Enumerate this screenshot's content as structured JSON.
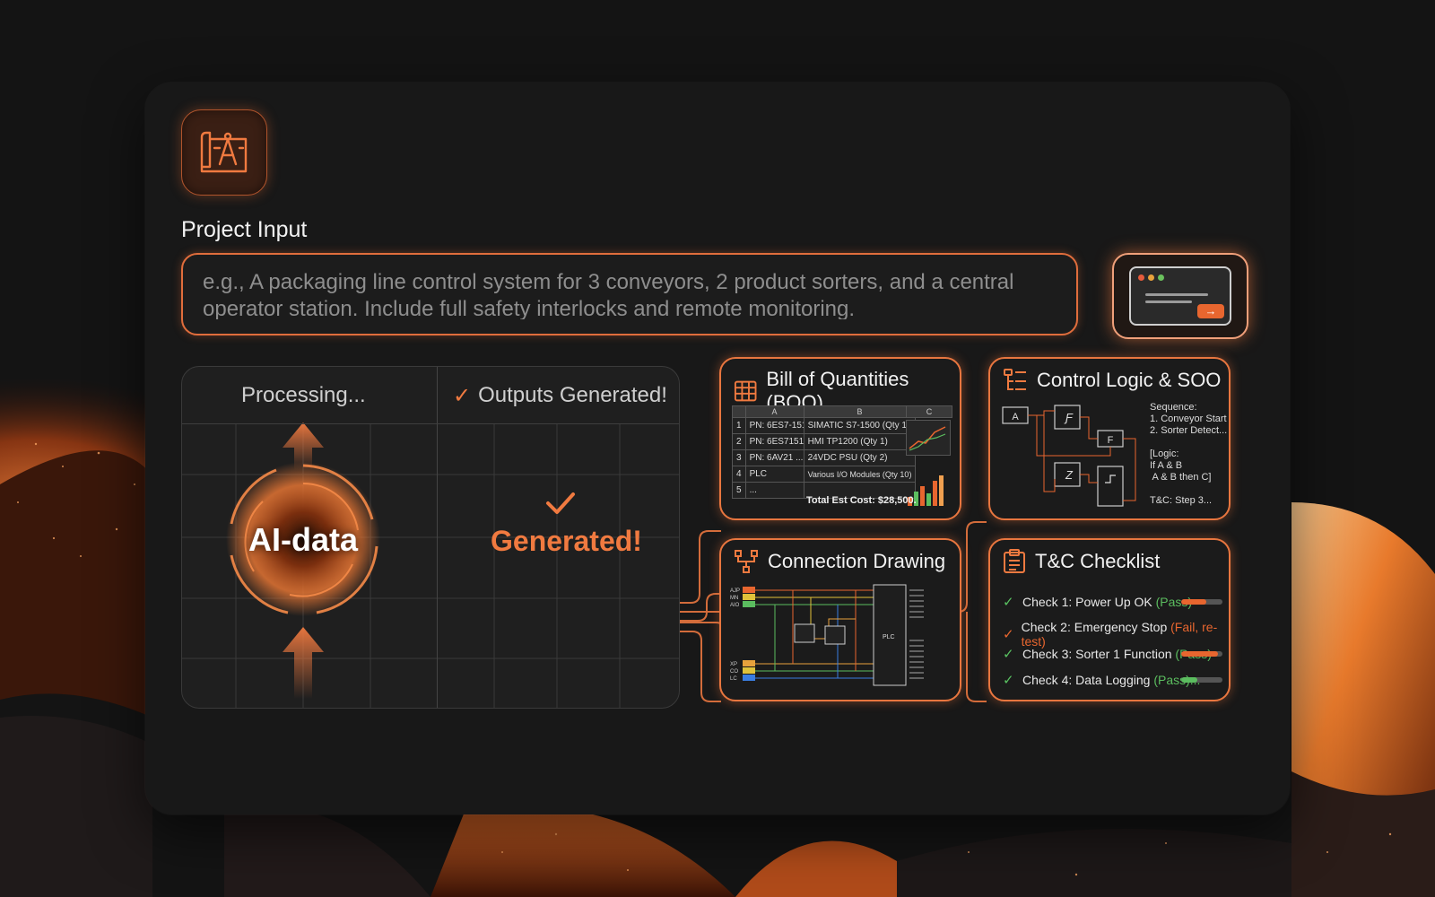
{
  "project": {
    "section_title": "Project Input",
    "placeholder": "e.g., A packaging line control system for 3 conveyors, 2 product sorters, and a central operator station. Include full safety interlocks and remote monitoring."
  },
  "processing": {
    "left_label": "Processing...",
    "right_label": "Outputs Generated!",
    "check_glyph": "✓",
    "core_label": "AI-data",
    "generated_label": "Generated!"
  },
  "submit": {
    "arrow": "→"
  },
  "boq": {
    "title": "Bill of Quantities (BOQ)",
    "columns": [
      "A",
      "B",
      "C"
    ],
    "rows": [
      {
        "num": "1",
        "a": "PN: 6ES7-151...",
        "b": "SIMATIC S7-1500 (Qty 1)"
      },
      {
        "num": "2",
        "a": "PN: 6ES7151...",
        "b": "HMI TP1200 (Qty 1)"
      },
      {
        "num": "3",
        "a": "PN: 6AV21 ...",
        "b": "24VDC PSU (Qty 2)"
      },
      {
        "num": "4",
        "a": "PLC",
        "b": "Various I/O Modules (Qty 10)"
      },
      {
        "num": "5",
        "a": "...",
        "b": ""
      }
    ],
    "total": "Total Est Cost: $28,500."
  },
  "logic": {
    "title": "Control Logic & SOO",
    "block_a": "A",
    "block_f": "F",
    "sequence": "Sequence:\n1. Conveyor Start\n2. Sorter Detect...\n\n[Logic:\nIf A & B\n A & B then C]\n\nT&C: Step 3..."
  },
  "drawing": {
    "title": "Connection Drawing",
    "plc_label": "PLC"
  },
  "checklist": {
    "title": "T&C Checklist",
    "items": [
      {
        "text": "Check 1: Power Up OK",
        "status": "(Pass)",
        "state": "pass",
        "progress": 0.6
      },
      {
        "text": "Check 2: Emergency Stop",
        "status": "(Fail, re-test)",
        "state": "fail",
        "progress": 0
      },
      {
        "text": "Check 3: Sorter 1 Function",
        "status": "(Pass)",
        "state": "pass",
        "progress": 0.9
      },
      {
        "text": "Check 4: Data Logging",
        "status": "(Pass)...",
        "state": "pass",
        "progress": 0.4
      }
    ]
  },
  "colors": {
    "accent": "#e8662f",
    "pass": "#5bbd5f",
    "fail": "#e8662f"
  }
}
